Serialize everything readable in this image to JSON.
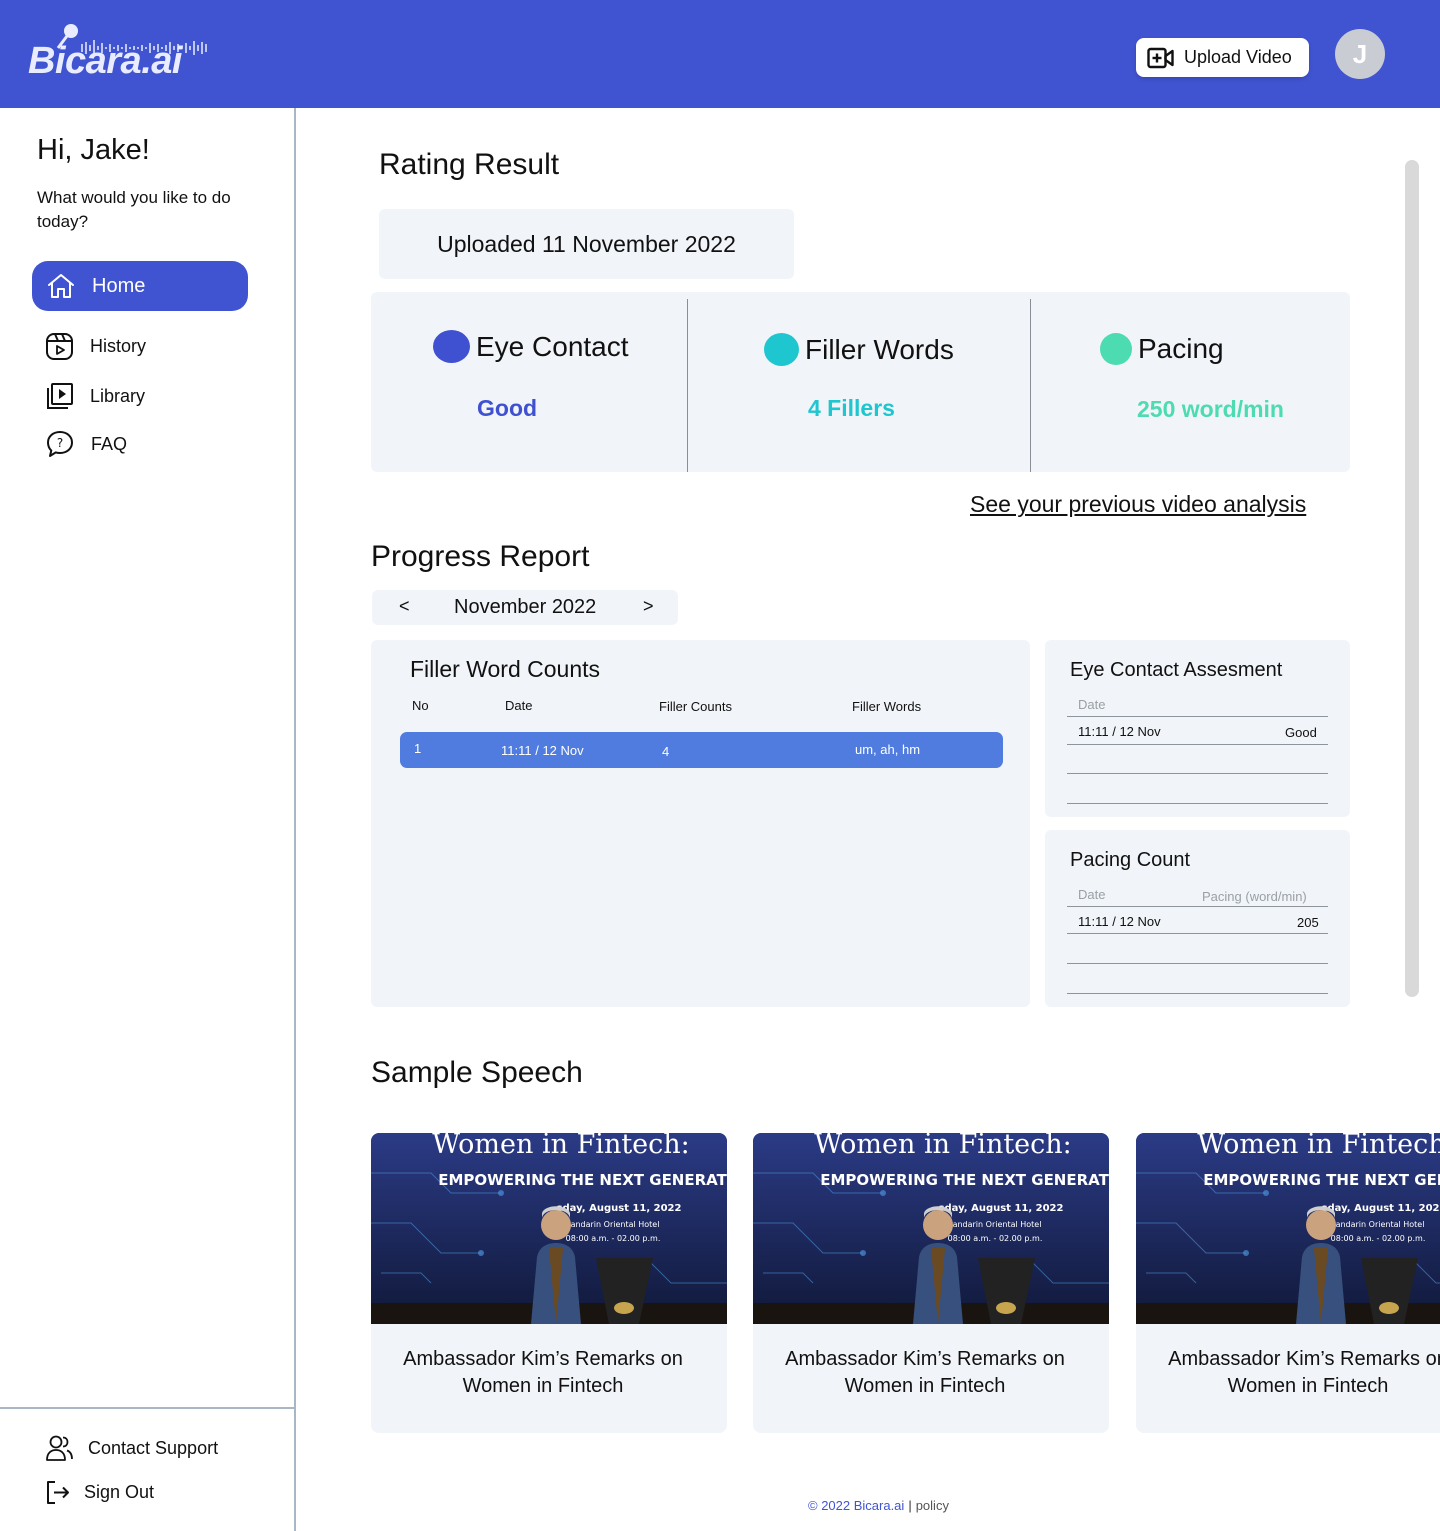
{
  "header": {
    "logo_text": "Bicara.ai",
    "upload_label": "Upload Video",
    "avatar_initial": "J"
  },
  "sidebar": {
    "greeting": "Hi, Jake!",
    "prompt": "What would you like to do today?",
    "items": [
      {
        "label": "Home",
        "icon": "home-icon",
        "active": true
      },
      {
        "label": "History",
        "icon": "history-icon"
      },
      {
        "label": "Library",
        "icon": "library-icon"
      },
      {
        "label": "FAQ",
        "icon": "faq-icon"
      }
    ],
    "bottom": [
      {
        "label": "Contact Support",
        "icon": "contact-support-icon"
      },
      {
        "label": "Sign Out",
        "icon": "sign-out-icon"
      }
    ]
  },
  "rating": {
    "title": "Rating Result",
    "uploaded": "Uploaded 11 November 2022",
    "metrics": [
      {
        "name": "Eye Contact",
        "value": "Good",
        "color": "#3f51d1"
      },
      {
        "name": "Filler Words",
        "value": "4 Fillers",
        "color": "#1ec6d0"
      },
      {
        "name": "Pacing",
        "value": "250 word/min",
        "color": "#4ddbb2"
      }
    ],
    "previous_link": "See your previous video analysis"
  },
  "progress": {
    "title": "Progress Report",
    "month": "November 2022",
    "prev": "<",
    "next": ">",
    "filler_table": {
      "title": "Filler Word Counts",
      "headers": [
        "No",
        "Date",
        "Filler Counts",
        "Filler Words"
      ],
      "rows": [
        {
          "no": "1",
          "date": "11:11 / 12 Nov",
          "count": "4",
          "words": "um, ah, hm"
        }
      ]
    },
    "eye_contact": {
      "title": "Eye Contact Assesment",
      "header_date": "Date",
      "rows": [
        {
          "date": "11:11 / 12 Nov",
          "value": "Good"
        }
      ]
    },
    "pacing": {
      "title": "Pacing Count",
      "header_date": "Date",
      "header_value": "Pacing (word/min)",
      "rows": [
        {
          "date": "11:11 / 12 Nov",
          "value": "205"
        }
      ]
    }
  },
  "samples": {
    "title": "Sample Speech",
    "thumb_heading": "Women in Fintech:",
    "thumb_sub": "EMPOWERING THE NEXT GENERATION",
    "thumb_date": "sday, August 11, 2022",
    "thumb_venue": "andarin Oriental Hotel",
    "thumb_time": "08:00 a.m. - 02.00 p.m.",
    "cards": [
      {
        "title": "Ambassador Kim’s Remarks on Women in Fintech"
      },
      {
        "title": "Ambassador Kim’s Remarks on Women in Fintech"
      },
      {
        "title": "Ambassador Kim’s Remarks on Women in Fintech"
      }
    ]
  },
  "footer": {
    "copyright": "© 2022 Bicara.ai",
    "separator": "|",
    "policy": "policy"
  }
}
